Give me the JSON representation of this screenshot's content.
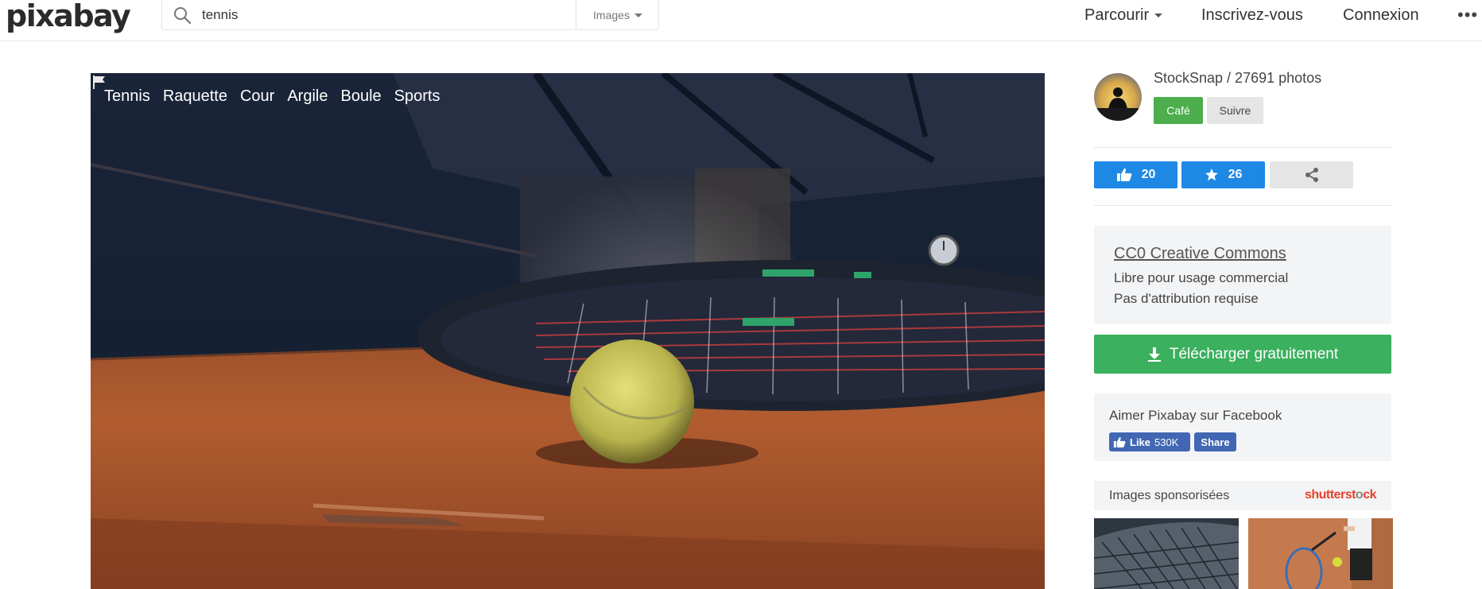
{
  "header": {
    "logo": "pixabay",
    "search": {
      "value": "tennis",
      "type_label": "Images"
    },
    "nav": {
      "browse": "Parcourir",
      "join": "Inscrivez-vous",
      "login": "Connexion",
      "more": "•••"
    }
  },
  "photo": {
    "tags": [
      "Tennis",
      "Raquette",
      "Cour",
      "Argile",
      "Boule",
      "Sports"
    ]
  },
  "sidebar": {
    "author": "StockSnap / 27691 photos",
    "coffee_label": "Café",
    "follow_label": "Suivre",
    "likes": "20",
    "favorites": "26",
    "license": {
      "title": "CC0 Creative Commons",
      "line1": "Libre pour usage commercial",
      "line2": "Pas d'attribution requise"
    },
    "download_label": "Télécharger gratuitement",
    "facebook": {
      "title": "Aimer Pixabay sur Facebook",
      "like_label": "Like",
      "like_count": "530K",
      "share_label": "Share"
    },
    "sponsored": {
      "title": "Images sponsorisées",
      "brand_a": "shutterst",
      "brand_b": "o",
      "brand_c": "ck"
    }
  },
  "colors": {
    "accent_blue": "#1e88e5",
    "download_green": "#3bb05e",
    "coffee_green": "#4cae4c",
    "facebook_blue": "#4267b2",
    "shutterstock_red": "#e8412b"
  }
}
